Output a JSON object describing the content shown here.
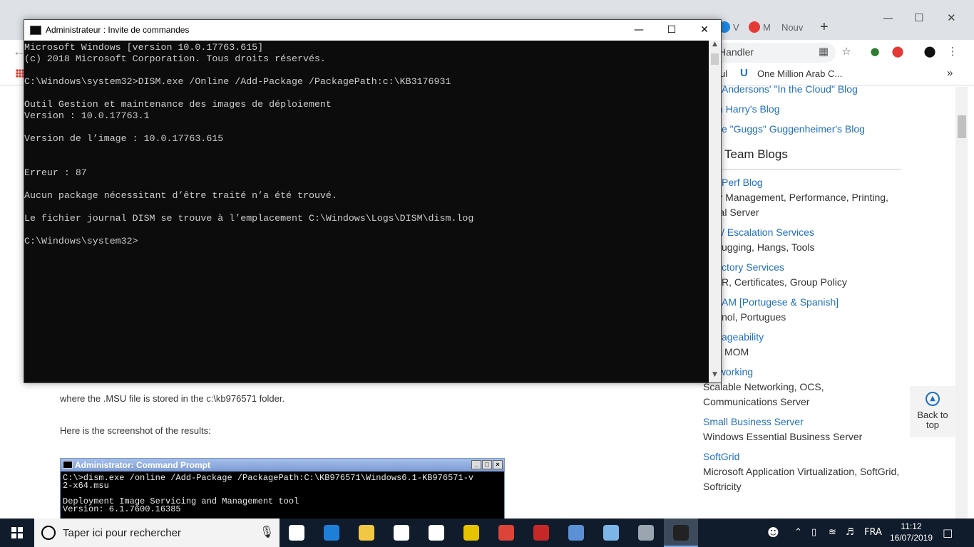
{
  "browser": {
    "tabs": [
      "V",
      "M",
      "Nouv"
    ],
    "new_tab": "+",
    "omnibox_text": "Handler",
    "bookmarks": [
      "ul",
      "One Million Arab C..."
    ],
    "bookmarks_more": "»",
    "win_controls": [
      "—",
      "☐",
      "✕"
    ]
  },
  "sidebar": {
    "top_links": [
      "Andersons' \"In the Cloud\" Blog",
      "n Harry's Blog",
      "e \"Guggs\" Guggenheimer's Blog"
    ],
    "section_heading": "Team Blogs",
    "entries": [
      {
        "link": "Perf Blog",
        "desc": "hory Management, Performance, Printing, minal Server"
      },
      {
        "link": "/ Escalation Services",
        "desc": "ugging, Hangs, Tools"
      },
      {
        "link": "ctory Services",
        "desc": "R, Certificates, Group Policy"
      },
      {
        "link": "AM [Portugese & Spanish]",
        "desc": "nol, Portugues"
      },
      {
        "link": "ageability",
        "desc": "MOM"
      },
      {
        "link": "Networking",
        "desc": "Scalable Networking, OCS, Communications Server"
      },
      {
        "link": "Small Business Server",
        "desc": "Windows Essential Business Server"
      },
      {
        "link": "SoftGrid",
        "desc": "Microsoft Application Virtualization, SoftGrid, Softricity"
      }
    ],
    "back_to_top": "Back to top"
  },
  "article": {
    "para1": "where the .MSU file is stored in the c:\\kb976571 folder.",
    "para2": "Here is the screenshot of the results:",
    "xp_title": "Administrator: Command Prompt",
    "xp_lines": [
      "C:\\>dism.exe /online /Add-Package /PackagePath:C:\\KB976571\\Windows6.1-KB976571-v",
      "2-x64.msu",
      "",
      "Deployment Image Servicing and Management tool",
      "Version: 6.1.7600.16385"
    ]
  },
  "cmd": {
    "title": "Administrateur : Invite de commandes",
    "lines": [
      "Microsoft Windows [version 10.0.17763.615]",
      "(c) 2018 Microsoft Corporation. Tous droits réservés.",
      "",
      "C:\\Windows\\system32>DISM.exe /Online /Add-Package /PackagePath:c:\\KB3176931",
      "",
      "Outil Gestion et maintenance des images de déploiement",
      "Version : 10.0.17763.1",
      "",
      "Version de l’image : 10.0.17763.615",
      "",
      "",
      "Erreur : 87",
      "",
      "Aucun package nécessitant d’être traité n’a été trouvé.",
      "",
      "Le fichier journal DISM se trouve à l’emplacement C:\\Windows\\Logs\\DISM\\dism.log",
      "",
      "C:\\Windows\\system32>"
    ],
    "controls": {
      "minimize": "—",
      "maximize": "☐",
      "close": "✕"
    }
  },
  "taskbar": {
    "search_placeholder": "Taper ici pour rechercher",
    "apps": [
      {
        "name": "task-view",
        "color": "#ffffff"
      },
      {
        "name": "edge",
        "color": "#1e7fd8"
      },
      {
        "name": "file-explorer",
        "color": "#f2c744"
      },
      {
        "name": "store",
        "color": "#ffffff"
      },
      {
        "name": "mail",
        "color": "#ffffff"
      },
      {
        "name": "pdf",
        "color": "#e6c200"
      },
      {
        "name": "chrome",
        "color": "#db4437"
      },
      {
        "name": "security-app",
        "color": "#c62828"
      },
      {
        "name": "qbittorrent",
        "color": "#5b8fd6"
      },
      {
        "name": "control-panel",
        "color": "#7cb5e8"
      },
      {
        "name": "tool-app",
        "color": "#9aa5b1"
      },
      {
        "name": "cmd",
        "color": "#222222"
      }
    ],
    "language": "FRA",
    "time": "11:12",
    "date": "16/07/2019"
  }
}
